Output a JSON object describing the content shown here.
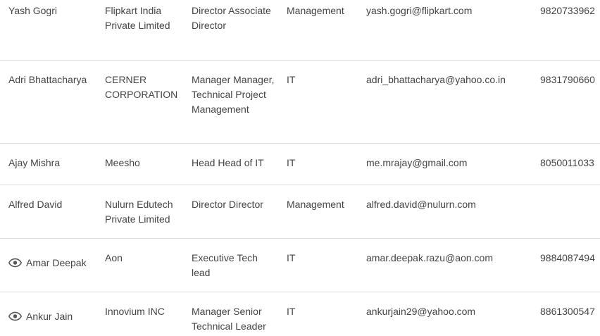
{
  "rows": [
    {
      "name": "Yash Gogri",
      "company": "Flipkart India Private Limited",
      "title": "Director Associate Director",
      "department": "Management",
      "email": "yash.gogri@flipkart.com",
      "phone": "9820733962",
      "icon": ""
    },
    {
      "name": "Adri Bhattacharya",
      "company": "CERNER CORPORATION",
      "title": "Manager Manager, Technical Project Management",
      "department": "IT",
      "email": "adri_bhattacharya@yahoo.co.in",
      "phone": "9831790660",
      "icon": ""
    },
    {
      "name": "Ajay Mishra",
      "company": "Meesho",
      "title": "Head Head of IT",
      "department": "IT",
      "email": "me.mrajay@gmail.com",
      "phone": "8050011033",
      "icon": ""
    },
    {
      "name": "Alfred David",
      "company": "Nulurn Edutech Private Limited",
      "title": "Director Director",
      "department": "Management",
      "email": "alfred.david@nulurn.com",
      "phone": "",
      "icon": ""
    },
    {
      "name": "Amar Deepak",
      "company": "Aon",
      "title": "Executive Tech lead",
      "department": "IT",
      "email": "amar.deepak.razu@aon.com",
      "phone": "9884087494",
      "icon": "eye-icon"
    },
    {
      "name": "Ankur Jain",
      "company": "Innovium INC",
      "title": "Manager Senior Technical Leader",
      "department": "IT",
      "email": "ankurjain29@yahoo.com",
      "phone": "8861300547",
      "icon": "eye-icon"
    }
  ]
}
